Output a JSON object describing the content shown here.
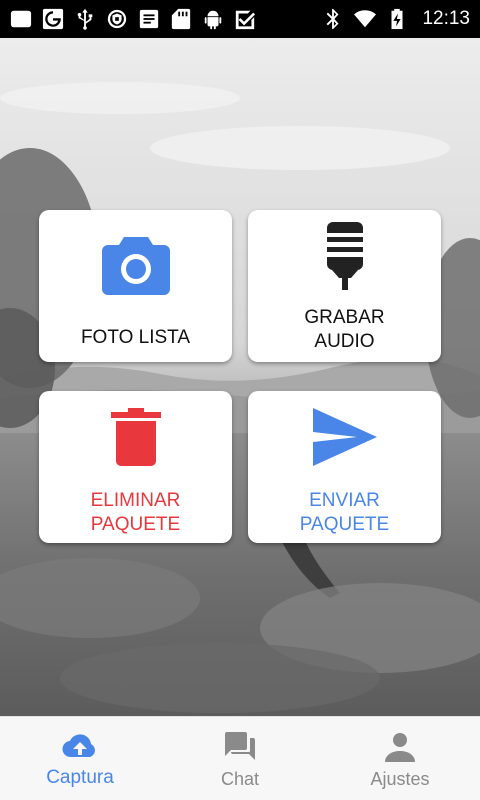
{
  "status_bar": {
    "time": "12:13",
    "left_icons": [
      "image-icon",
      "google-icon",
      "usb-icon",
      "vpn-shield-icon",
      "notes-icon",
      "sd-card-icon",
      "android-icon",
      "checkbox-icon"
    ],
    "right_icons": [
      "bluetooth-icon",
      "wifi-icon",
      "battery-charging-icon"
    ]
  },
  "tiles": {
    "foto": {
      "label": "FOTO LISTA",
      "icon": "camera-icon",
      "color": "#4a86e8",
      "text_color": "#111111"
    },
    "audio": {
      "label": "GRABAR\nAUDIO",
      "icon": "microphone-icon",
      "color": "#222222",
      "text_color": "#111111"
    },
    "eliminar": {
      "label": "ELIMINAR\nPAQUETE",
      "icon": "trash-icon",
      "color": "#e8383d",
      "text_color": "#e8383d"
    },
    "enviar": {
      "label": "ENVIAR\nPAQUETE",
      "icon": "send-icon",
      "color": "#4a86e8",
      "text_color": "#4a86e8"
    }
  },
  "bottom_nav": {
    "items": [
      {
        "label": "Captura",
        "icon": "cloud-upload-icon",
        "active": true
      },
      {
        "label": "Chat",
        "icon": "chat-icon",
        "active": false
      },
      {
        "label": "Ajustes",
        "icon": "person-icon",
        "active": false
      }
    ],
    "active_color": "#4a86e8",
    "inactive_color": "#8a8a8a"
  }
}
